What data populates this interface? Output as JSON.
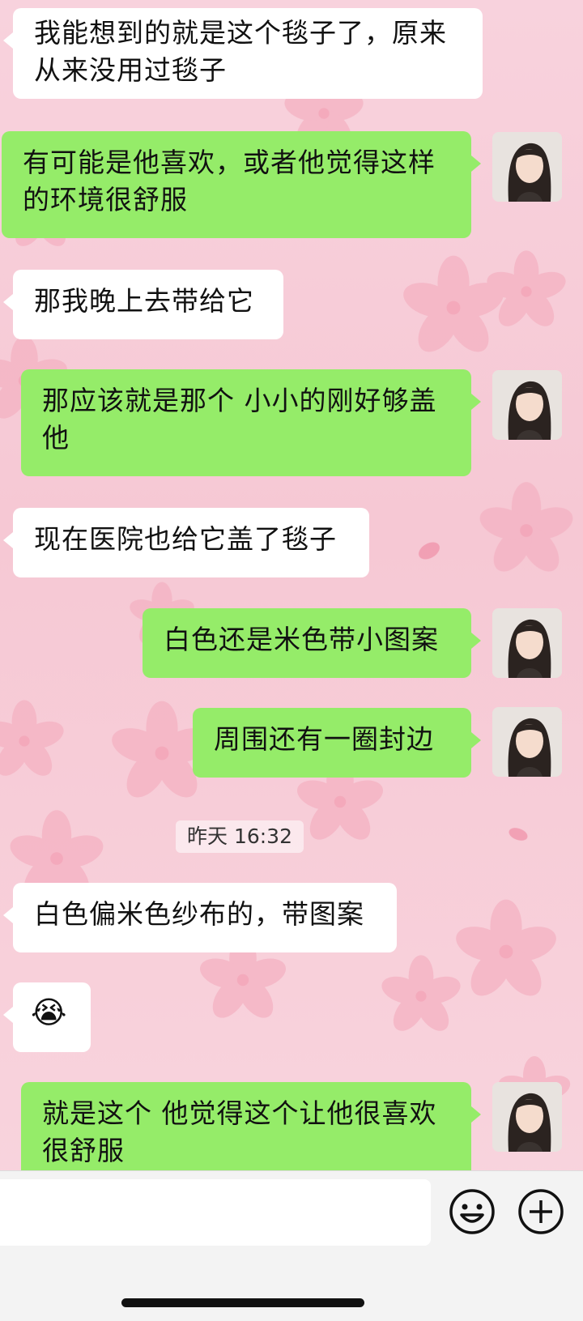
{
  "messages": [
    {
      "side": "in",
      "text": "我能想到的就是这个毯子了，原来从来没用过毯子"
    },
    {
      "side": "out",
      "text": "有可能是他喜欢，或者他觉得这样的环境很舒服"
    },
    {
      "side": "in",
      "text": "那我晚上去带给它"
    },
    {
      "side": "out",
      "text": "那应该就是那个 小小的刚好够盖他"
    },
    {
      "side": "in",
      "text": "现在医院也给它盖了毯子"
    },
    {
      "side": "out",
      "text": "白色还是米色带小图案"
    },
    {
      "side": "out",
      "text": "周围还有一圈封边"
    },
    {
      "side": "in",
      "text": "白色偏米色纱布的，带图案"
    },
    {
      "side": "in",
      "text": "😭"
    },
    {
      "side": "out",
      "text": "就是这个 他觉得这个让他很喜欢很舒服"
    }
  ],
  "timestamp": "昨天 16:32",
  "input_bar": {
    "placeholder": "",
    "icons": [
      "emoji-icon",
      "plus-icon"
    ]
  },
  "colors": {
    "outgoing_bubble": "#95ec69",
    "incoming_bubble": "#ffffff",
    "background": "#f7cdd8"
  }
}
